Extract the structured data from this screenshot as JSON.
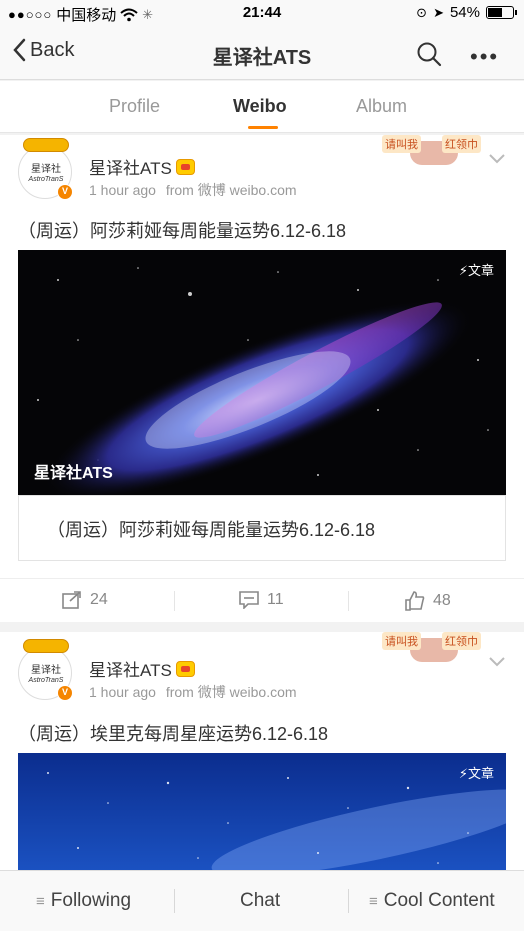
{
  "status_bar": {
    "carrier": "中国移动",
    "time": "21:44",
    "battery": "54%"
  },
  "nav": {
    "back_label": "Back",
    "title": "星译社ATS"
  },
  "tabs": [
    {
      "label": "Profile",
      "active": false
    },
    {
      "label": "Weibo",
      "active": true
    },
    {
      "label": "Album",
      "active": false
    }
  ],
  "accent_color": "#ff8200",
  "posts": [
    {
      "avatar_text": "星译社",
      "avatar_subtext": "AstroTranS",
      "username": "星译社ATS",
      "time": "1 hour ago",
      "source": "from 微博 weibo.com",
      "banner_text_left": "请叫我",
      "banner_text_right": "红领巾",
      "text": "（周运）阿莎莉娅每周能量运势6.12-6.18",
      "image_badge": "⚡文章",
      "image_watermark": "星译社ATS",
      "preview_text": "（周运）阿莎莉娅每周能量运势6.12-6.18",
      "actions": {
        "repost": "24",
        "comment": "11",
        "like": "48"
      }
    },
    {
      "avatar_text": "星译社",
      "avatar_subtext": "AstroTranS",
      "username": "星译社ATS",
      "time": "1 hour ago",
      "source": "from 微博 weibo.com",
      "banner_text_left": "请叫我",
      "banner_text_right": "红领巾",
      "text": "（周运）埃里克每周星座运势6.12-6.18",
      "image_badge": "⚡文章"
    }
  ],
  "bottom_bar": {
    "following": "Following",
    "chat": "Chat",
    "cool_content": "Cool Content"
  }
}
